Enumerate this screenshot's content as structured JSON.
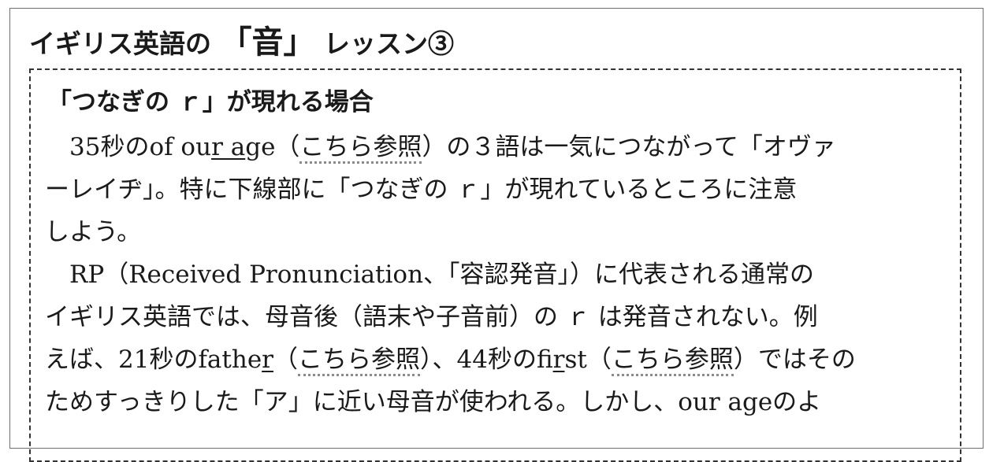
{
  "title": {
    "prefix": "イギリス英語の",
    "open": "「",
    "word": "音",
    "close": "」",
    "suffix": "レッスン③"
  },
  "section_heading": "「つなぎの ｒ」が現れる場合",
  "link_text": "こちら参照",
  "paragraph1": {
    "line1": {
      "a": "　35秒のof ou",
      "u1": "r a",
      "b": "ge（",
      "c": "）の３語は一気につながって「オヴァ"
    },
    "line2": "ーレイヂ」。特に下線部に「つなぎの ｒ」が現れているところに注意",
    "line3": "しよう。"
  },
  "paragraph2": {
    "line1": "　RP（Received Pronunciation、「容認発音」）に代表される通常の",
    "line2": "イギリス英語では、母音後（語末や子音前）の ｒ は発音されない。例",
    "line3": {
      "a": "えば、21秒のfathe",
      "u1": "r",
      "b": "（",
      "c": "）、44秒のfi",
      "u2": "r",
      "d": "st（",
      "e": "）ではその"
    },
    "line4": "ためすっきりした「ア」に近い母音が使われる。しかし、our ageのよ"
  }
}
